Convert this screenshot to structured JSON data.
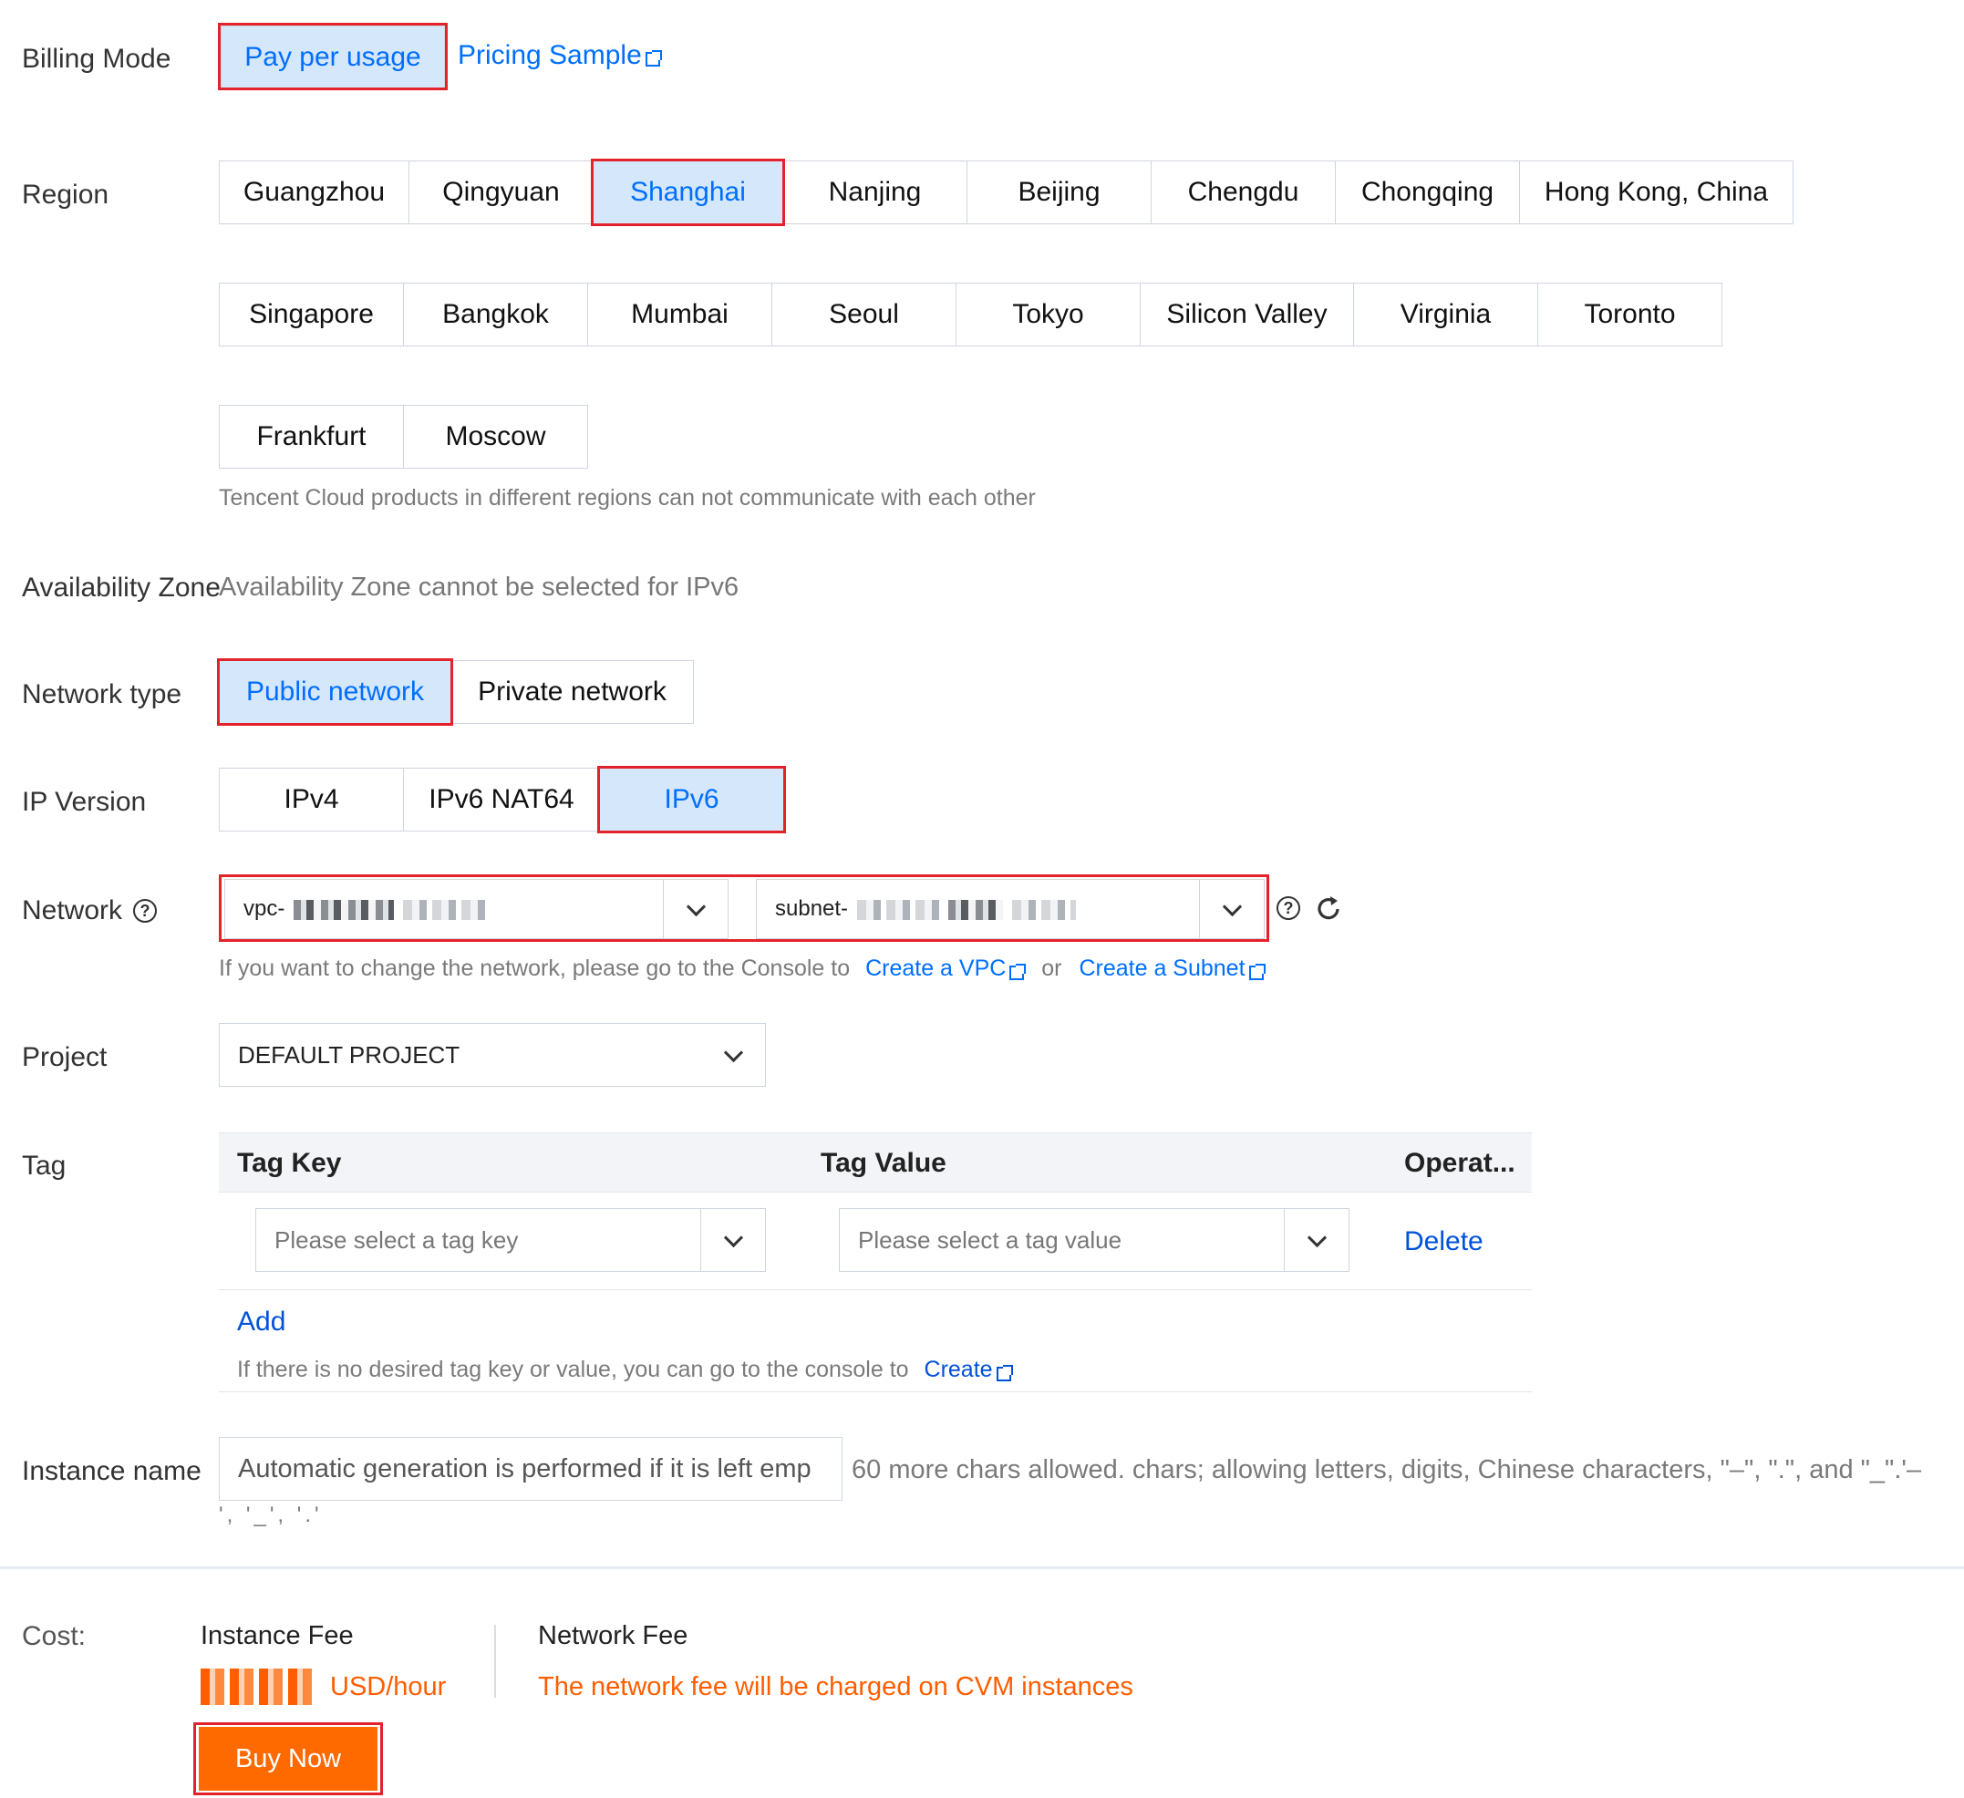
{
  "billing": {
    "label": "Billing Mode",
    "option": "Pay per usage",
    "pricing_link": "Pricing Sample"
  },
  "region": {
    "label": "Region",
    "row1": [
      "Guangzhou",
      "Qingyuan",
      "Shanghai",
      "Nanjing",
      "Beijing",
      "Chengdu",
      "Chongqing",
      "Hong Kong, China"
    ],
    "row2": [
      "Singapore",
      "Bangkok",
      "Mumbai",
      "Seoul",
      "Tokyo",
      "Silicon Valley",
      "Virginia",
      "Toronto"
    ],
    "row3": [
      "Frankfurt",
      "Moscow"
    ],
    "selected": "Shanghai",
    "hint": "Tencent Cloud products in different regions can not communicate with each other"
  },
  "availability": {
    "label": "Availability Zone",
    "text": "Availability Zone cannot be selected for IPv6"
  },
  "network_type": {
    "label": "Network type",
    "options": [
      "Public network",
      "Private network"
    ],
    "selected": "Public network"
  },
  "ip_version": {
    "label": "IP Version",
    "options": [
      "IPv4",
      "IPv6 NAT64",
      "IPv6"
    ],
    "selected": "IPv6"
  },
  "network": {
    "label": "Network",
    "vpc_prefix": "vpc-",
    "subnet_prefix": "subnet-",
    "hint_prefix": "If you want to change the network, please go to the Console to",
    "create_vpc": "Create a VPC",
    "or": "or",
    "create_subnet": "Create a Subnet"
  },
  "project": {
    "label": "Project",
    "value": "DEFAULT PROJECT"
  },
  "tag": {
    "label": "Tag",
    "col_key": "Tag Key",
    "col_value": "Tag Value",
    "col_op": "Operat...",
    "key_placeholder": "Please select a tag key",
    "value_placeholder": "Please select a tag value",
    "delete": "Delete",
    "add": "Add",
    "hint_prefix": "If there is no desired tag key or value, you can go to the console to",
    "create": "Create"
  },
  "instance_name": {
    "label": "Instance name",
    "placeholder": "Automatic generation is performed if it is left emp",
    "hint_line1": "60 more chars allowed. chars; allowing letters, digits, Chinese characters, \"–\", \".\", and \"_\".'–",
    "hint_line2": "', '_', '.'"
  },
  "cost": {
    "label": "Cost:",
    "instance_fee": "Instance Fee",
    "unit": "USD/hour",
    "network_fee": "Network Fee",
    "network_note": "The network fee will be charged on CVM instances",
    "buy": "Buy Now"
  },
  "colors": {
    "selected_bg": "#d5e7fb",
    "selected_text": "#006eff",
    "highlight": "#e3232c",
    "orange": "#ff5d00"
  }
}
